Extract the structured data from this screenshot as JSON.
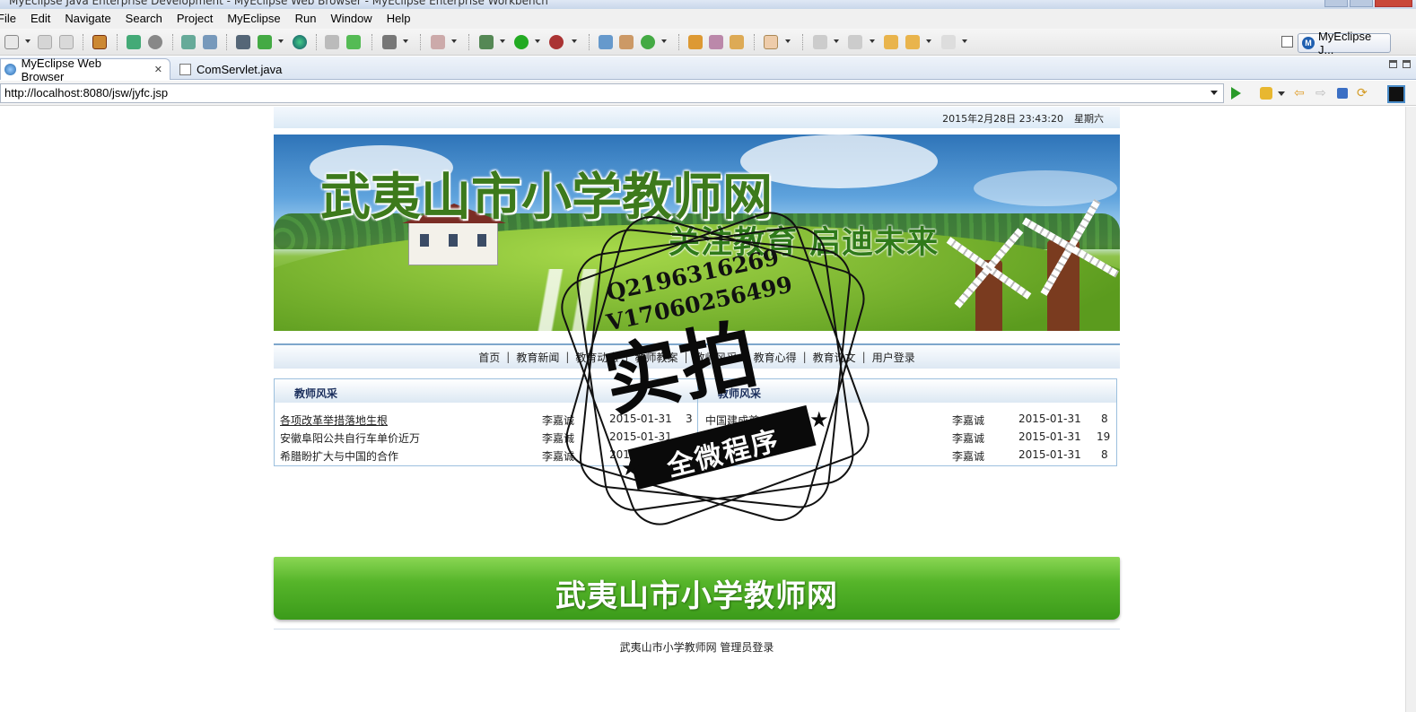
{
  "window": {
    "title": "MyEclipse Java Enterprise Development - MyEclipse Web Browser - MyEclipse Enterprise Workbench"
  },
  "menu": [
    "File",
    "Edit",
    "Navigate",
    "Search",
    "Project",
    "MyEclipse",
    "Run",
    "Window",
    "Help"
  ],
  "perspective": {
    "label": "MyEclipse J...",
    "icon": "myeclipse-logo-icon"
  },
  "tabs": [
    {
      "label": "MyEclipse Web Browser",
      "icon": "globe-icon",
      "active": true
    },
    {
      "label": "ComServlet.java",
      "icon": "java-file-icon",
      "active": false
    }
  ],
  "browser": {
    "url": "http://localhost:8080/jsw/jyfc.jsp"
  },
  "site": {
    "date": "2015年2月28日 23:43:20",
    "weekday": "星期六",
    "banner_title": "武夷山市小学教师网",
    "banner_slogan": "关注教育  启迪未来",
    "nav": [
      "首页",
      "教育新闻",
      "教育动态",
      "教师教案",
      "教师风采",
      "教育心得",
      "教育论文",
      "用户登录"
    ],
    "left_box": {
      "title": "教师风采",
      "rows": [
        {
          "title": "各项改革举措落地生根",
          "author": "李嘉诚",
          "date": "2015-01-31",
          "count": "3"
        },
        {
          "title": "安徽阜阳公共自行车单价近万",
          "author": "李嘉诚",
          "date": "2015-01-31",
          "count": ""
        },
        {
          "title": "希腊盼扩大与中国的合作",
          "author": "李嘉诚",
          "date": "2015-01-31",
          "count": ""
        }
      ]
    },
    "right_box": {
      "title": "教师风采",
      "rows": [
        {
          "title": "中国建成首",
          "author": "李嘉诚",
          "date": "2015-01-31",
          "count": "8"
        },
        {
          "title": "",
          "author": "李嘉诚",
          "date": "2015-01-31",
          "count": "19"
        },
        {
          "title": "",
          "author": "李嘉诚",
          "date": "2015-01-31",
          "count": "8"
        }
      ]
    },
    "footer_banner": "武夷山市小学教师网",
    "footer_links": [
      "武夷山市小学教师网",
      "管理员登录"
    ]
  },
  "watermark": {
    "line1": "Q2196316269",
    "line2": "V17060256499",
    "main": "实拍",
    "ribbon": "全微程序"
  }
}
